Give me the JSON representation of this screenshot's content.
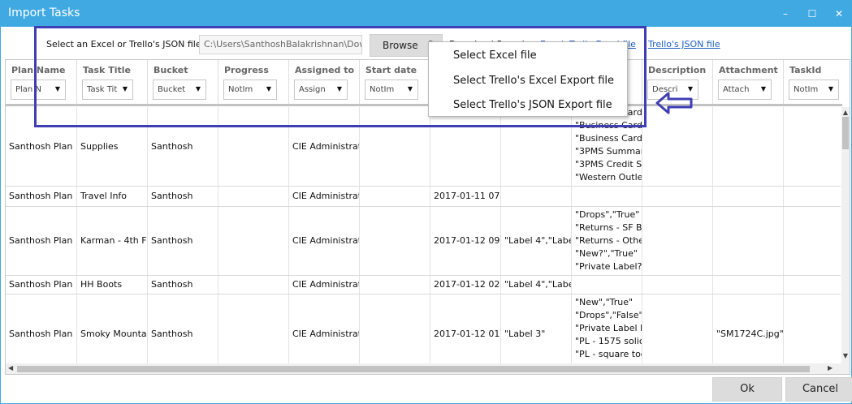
{
  "window": {
    "title": "Import Tasks",
    "controls": {
      "minimize": "–",
      "maximize": "☐",
      "close": "✕"
    }
  },
  "toolbar": {
    "file_label": "Select an Excel or Trello's JSON file:",
    "file_path": "C:\\Users\\SanthoshBalakrishnan\\Dow",
    "browse_label": "Browse",
    "partial_text_1": "Download Sample:",
    "partial_text_2": "Excel",
    "partial_text_3": "Trello Excel file",
    "trello_json_link": "Trello's JSON file"
  },
  "menu": {
    "items": [
      "Select Excel file",
      "Select Trello's Excel Export file",
      "Select Trello's JSON Export file"
    ]
  },
  "columns": [
    {
      "label": "Plan Name",
      "filter": "Plan N"
    },
    {
      "label": "Task Title",
      "filter": "Task Tit"
    },
    {
      "label": "Bucket",
      "filter": "Bucket"
    },
    {
      "label": "Progress",
      "filter": "NotIm"
    },
    {
      "label": "Assigned to",
      "filter": "Assign"
    },
    {
      "label": "Start date",
      "filter": "NotIm"
    },
    {
      "label": "",
      "filter": ""
    },
    {
      "label": "",
      "filter": ""
    },
    {
      "label": "",
      "filter": ""
    },
    {
      "label": "Description",
      "filter": "Descri"
    },
    {
      "label": "Attachment",
      "filter": "Attach"
    },
    {
      "label": "TaskId",
      "filter": "NotIm"
    }
  ],
  "rows": [
    {
      "plan": "Santhosh Plan",
      "title": "Supplies",
      "bucket": "Santhosh",
      "progress": "",
      "assigned": "CIE Administrat",
      "start": "",
      "due": "",
      "labels": "",
      "checklist": [
        "\"Business Cards - List",
        "\"Business Cards\"",
        "\"Business Cards",
        "\"3PMS Summar",
        "\"3PMS Credit S",
        "\"Western Outle"
      ],
      "description": "",
      "attachment": "",
      "taskid": ""
    },
    {
      "plan": "Santhosh Plan",
      "title": "Travel Info",
      "bucket": "Santhosh",
      "progress": "",
      "assigned": "CIE Administrat",
      "start": "",
      "due": "2017-01-11 07:",
      "labels": "",
      "checklist": [],
      "description": "",
      "attachment": "",
      "taskid": ""
    },
    {
      "plan": "Santhosh Plan",
      "title": "Karman - 4th Fl",
      "bucket": "Santhosh",
      "progress": "",
      "assigned": "CIE Administrat",
      "start": "",
      "due": "2017-01-12 09:",
      "labels": "\"Label 4\",\"Labe",
      "checklist": [
        "\"Drops\",\"True\"",
        "\"Returns - SF Bo",
        "\"Returns - Othe",
        "\"New?\",\"True\"",
        "\"Private Label?\""
      ],
      "description": "",
      "attachment": "",
      "taskid": ""
    },
    {
      "plan": "Santhosh Plan",
      "title": "HH Boots",
      "bucket": "Santhosh",
      "progress": "",
      "assigned": "CIE Administrat",
      "start": "",
      "due": "2017-01-12 02:",
      "labels": "\"Label 4\",\"Labe",
      "checklist": [],
      "description": "",
      "attachment": "",
      "taskid": ""
    },
    {
      "plan": "Santhosh Plan",
      "title": "Smoky Mounta",
      "bucket": "Santhosh",
      "progress": "",
      "assigned": "CIE Administrat",
      "start": "",
      "due": "2017-01-12 01:",
      "labels": "\"Label 3\"",
      "checklist": [
        "\"New\",\"True\"",
        "\"Drops\",\"False\"",
        "\"Private Label b",
        "\"PL - 1575 solic",
        "\"PL - square too"
      ],
      "description": "",
      "attachment": "\"SM1724C.jpg\"",
      "taskid": ""
    }
  ],
  "buttons": {
    "ok": "Ok",
    "cancel": "Cancel"
  },
  "colors": {
    "titlebar": "#41a9e2",
    "highlight": "#3f3fb5",
    "link": "#1a5fc0"
  }
}
